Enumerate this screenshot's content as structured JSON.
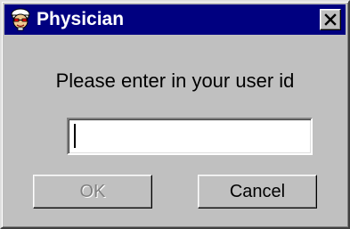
{
  "window": {
    "title": "Physician",
    "icon": "physician-app-icon",
    "close_icon": "close-x-icon"
  },
  "dialog": {
    "prompt": "Please enter in your user id",
    "userid_value": "",
    "userid_placeholder": ""
  },
  "buttons": {
    "ok_label": "OK",
    "ok_enabled": false,
    "cancel_label": "Cancel"
  },
  "colors": {
    "titlebar": "#000080",
    "face": "#c0c0c0",
    "disabled_text": "#808080"
  }
}
